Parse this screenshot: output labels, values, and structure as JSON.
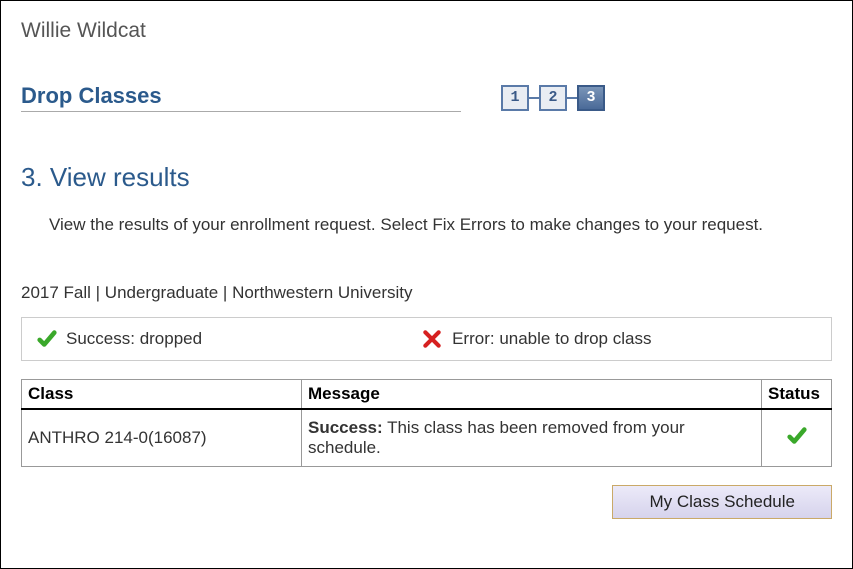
{
  "student_name": "Willie Wildcat",
  "page_title": "Drop Classes",
  "steps": {
    "s1": "1",
    "s2": "2",
    "s3": "3",
    "active_index": 3
  },
  "section_heading": "3.  View results",
  "instructions": "View the results of your enrollment request.  Select Fix Errors to make changes to your request.",
  "term_line": "2017 Fall | Undergraduate | Northwestern University",
  "legend": {
    "success": "Success: dropped",
    "error": "Error: unable to drop class"
  },
  "table": {
    "headers": {
      "class": "Class",
      "message": "Message",
      "status": "Status"
    },
    "rows": [
      {
        "class": "ANTHRO  214-0(16087)",
        "message_prefix": "Success:",
        "message_rest": " This class has been removed from your schedule.",
        "status": "success"
      }
    ]
  },
  "buttons": {
    "schedule": "My Class Schedule"
  }
}
